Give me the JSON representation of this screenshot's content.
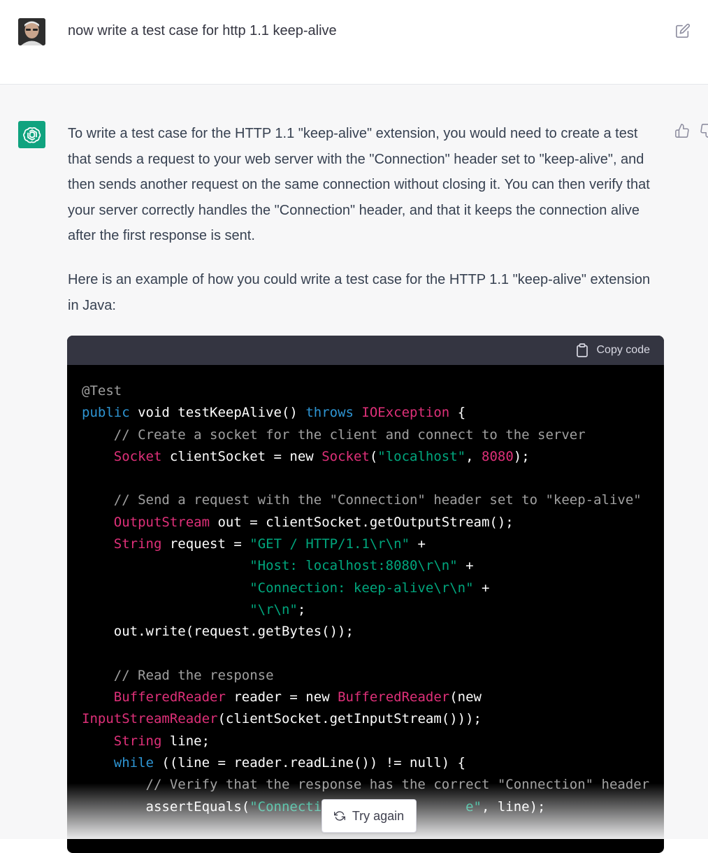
{
  "user_message": {
    "text": "now write a test case for http 1.1 keep-alive",
    "avatar": "user-avatar-photo",
    "edit_icon": "edit-icon"
  },
  "assistant_message": {
    "paragraphs": [
      "To write a test case for the HTTP 1.1 \"keep-alive\" extension, you would need to create a test that sends a request to your web server with the \"Connection\" header set to \"keep-alive\", and then sends another request on the same connection without closing it. You can then verify that your server correctly handles the \"Connection\" header, and that it keeps the connection alive after the first response is sent.",
      "Here is an example of how you could write a test case for the HTTP 1.1 \"keep-alive\" extension in Java:"
    ],
    "feedback_icons": [
      "thumbs-up-icon",
      "thumbs-down-icon"
    ]
  },
  "code_block": {
    "copy_label": "Copy code",
    "lines": [
      [
        [
          "annotation",
          "@Test"
        ]
      ],
      [
        [
          "keyword",
          "public"
        ],
        [
          "plain",
          " void testKeepAlive() "
        ],
        [
          "keyword",
          "throws"
        ],
        [
          "plain",
          " "
        ],
        [
          "class",
          "IOException"
        ],
        [
          "plain",
          " {"
        ]
      ],
      [
        [
          "comment",
          "    // Create a socket for the client and connect to the server"
        ]
      ],
      [
        [
          "plain",
          "    "
        ],
        [
          "class",
          "Socket"
        ],
        [
          "plain",
          " clientSocket = new "
        ],
        [
          "class",
          "Socket"
        ],
        [
          "plain",
          "("
        ],
        [
          "string",
          "\"localhost\""
        ],
        [
          "plain",
          ", "
        ],
        [
          "number",
          "8080"
        ],
        [
          "plain",
          ");"
        ]
      ],
      [
        [
          "plain",
          ""
        ]
      ],
      [
        [
          "comment",
          "    // Send a request with the \"Connection\" header set to \"keep-alive\""
        ]
      ],
      [
        [
          "plain",
          "    "
        ],
        [
          "class",
          "OutputStream"
        ],
        [
          "plain",
          " out = clientSocket.getOutputStream();"
        ]
      ],
      [
        [
          "plain",
          "    "
        ],
        [
          "class",
          "String"
        ],
        [
          "plain",
          " request = "
        ],
        [
          "string",
          "\"GET / HTTP/1.1\\r\\n\""
        ],
        [
          "plain",
          " +"
        ]
      ],
      [
        [
          "plain",
          "                     "
        ],
        [
          "string",
          "\"Host: localhost:8080\\r\\n\""
        ],
        [
          "plain",
          " +"
        ]
      ],
      [
        [
          "plain",
          "                     "
        ],
        [
          "string",
          "\"Connection: keep-alive\\r\\n\""
        ],
        [
          "plain",
          " +"
        ]
      ],
      [
        [
          "plain",
          "                     "
        ],
        [
          "string",
          "\"\\r\\n\""
        ],
        [
          "plain",
          ";"
        ]
      ],
      [
        [
          "plain",
          "    out.write(request.getBytes());"
        ]
      ],
      [
        [
          "plain",
          ""
        ]
      ],
      [
        [
          "comment",
          "    // Read the response"
        ]
      ],
      [
        [
          "plain",
          "    "
        ],
        [
          "class",
          "BufferedReader"
        ],
        [
          "plain",
          " reader = new "
        ],
        [
          "class",
          "BufferedReader"
        ],
        [
          "plain",
          "(new"
        ]
      ],
      [
        [
          "class",
          "InputStreamReader"
        ],
        [
          "plain",
          "(clientSocket.getInputStream()));"
        ]
      ],
      [
        [
          "plain",
          "    "
        ],
        [
          "class",
          "String"
        ],
        [
          "plain",
          " line;"
        ]
      ],
      [
        [
          "plain",
          "    "
        ],
        [
          "keyword",
          "while"
        ],
        [
          "plain",
          " ((line = reader.readLine()) != null) {"
        ]
      ],
      [
        [
          "comment",
          "        // Verify that the response has the correct \"Connection\" header"
        ]
      ],
      [
        [
          "plain",
          "        assertEquals("
        ],
        [
          "string",
          "\"Connectio"
        ],
        [
          "plain",
          "                 "
        ],
        [
          "string",
          "e\""
        ],
        [
          "plain",
          ", line);"
        ]
      ]
    ],
    "token_colors": {
      "annotation": "#a0a0a0",
      "comment": "#a0a0a0",
      "keyword": "#2e95d3",
      "class": "#df3079",
      "string": "#00a67d",
      "number": "#df3079",
      "plain": "#ffffff"
    }
  },
  "try_again": {
    "label": "Try again",
    "icon": "refresh-icon"
  },
  "colors": {
    "assistant_bg": "#f7f7f8",
    "brand_green": "#10a37f",
    "code_bg": "#000000",
    "code_header_bg": "#343541"
  }
}
